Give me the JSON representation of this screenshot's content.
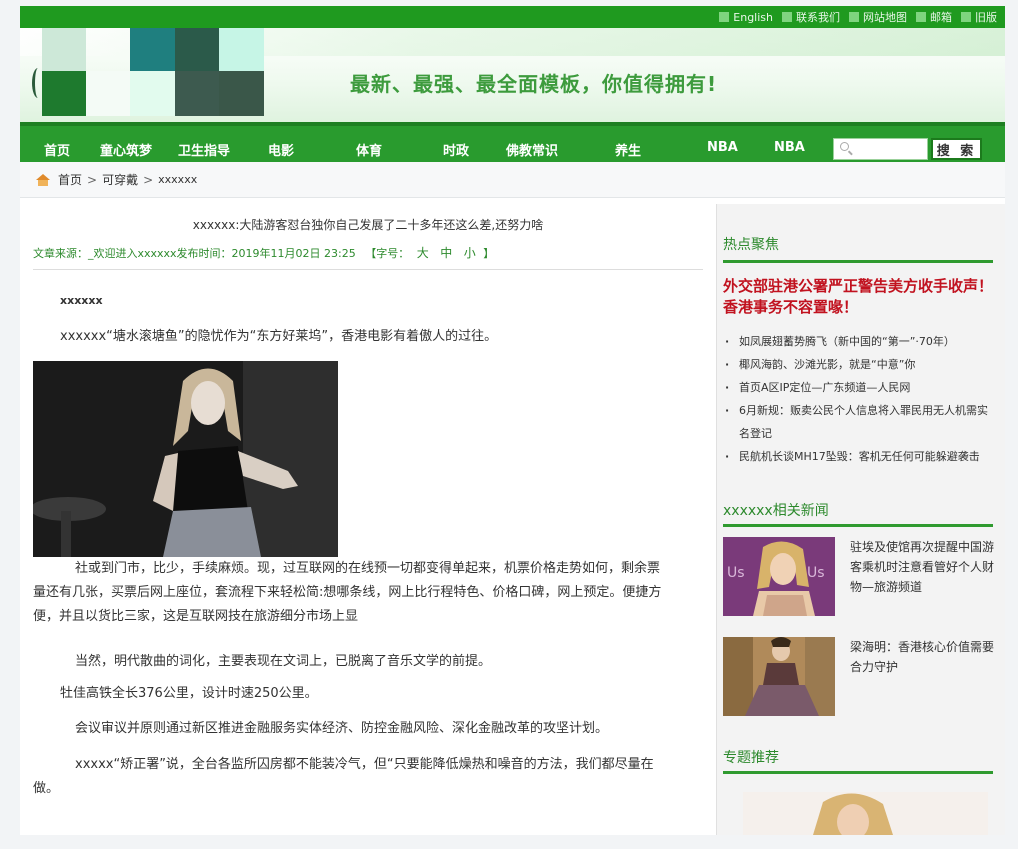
{
  "topbar": {
    "links": [
      "English",
      "联系我们",
      "网站地图",
      "邮箱",
      "旧版"
    ]
  },
  "header": {
    "slogan": "最新、最强、最全面模板，你值得拥有!"
  },
  "nav": {
    "items": [
      "首页",
      "童心筑梦",
      "卫生指导",
      "电影",
      "体育",
      "时政",
      "佛教常识",
      "养生",
      "NBA",
      "NBA"
    ],
    "search_placeholder": "",
    "search_button": "搜 索"
  },
  "breadcrumb": {
    "home": "首页",
    "level1": "可穿戴",
    "level2": "xxxxxx"
  },
  "article": {
    "title": "xxxxxx:大陆游客怼台独你自己发展了二十多年还这么差,还努力啥",
    "meta": "文章来源：_欢迎进入xxxxxx发布时间：2019年11月02日 23:25",
    "font_size_label": "【字号：",
    "size_large": "大",
    "size_medium": "中",
    "size_small": "小",
    "size_close": "】",
    "p1": "xxxxxx",
    "p2": "xxxxxx“塘水滚塘鱼”的隐忧作为“东方好莱坞”，香港电影有着傲人的过往。",
    "p3_line1": "社或到门市，比少，手续麻烦。现，过互联网的在线预一切都变得单起来，机票价格走势如何，剩余票",
    "p3_line2": "量还有几张，买票后网上座位，套流程下来轻松简:想哪条线，网上比行程特色、价格口碑，网上预定。便捷方",
    "p3_line3": "便，并且以货比三家，这是互联网技在旅游细分市场上显",
    "p4": "当然，明代散曲的词化，主要表现在文词上，已脱离了音乐文学的前提。",
    "p5": "牡佳高铁全长376公里，设计时速250公里。",
    "p6": "会议审议并原则通过新区推进金融服务实体经济、防控金融风险、深化金融改革的攻坚计划。",
    "p7_line1": "xxxxx“矫正署”说，全台各监所囚房都不能装冷气，但“只要能降低燥热和噪音的方法，我们都尽量在",
    "p7_line2": "做。"
  },
  "sidebar": {
    "hot_heading": "热点聚焦",
    "hot_title": "外交部驻港公署严正警告美方收手收声！香港事务不容置喙！",
    "hot_list": [
      "如凤展翅蓄势腾飞（新中国的“第一”·70年）",
      "椰风海韵、沙滩光影，就是“中意”你",
      "首页A区IP定位—广东频道—人民网",
      "6月新规：贩卖公民个人信息将入罪民用无人机需实名登记",
      "民航机长谈MH17坠毁：客机无任何可能躲避袭击"
    ],
    "related_heading": "xxxxxx相关新闻",
    "related": [
      "驻埃及使馆再次提醒中国游客乘机时注意看管好个人财物—旅游频道",
      "梁海明：香港核心价值需要合力守护"
    ],
    "topic_heading": "专题推荐"
  },
  "colors": {
    "brand_green": "#299b2e",
    "hot_red": "#c1121f"
  }
}
